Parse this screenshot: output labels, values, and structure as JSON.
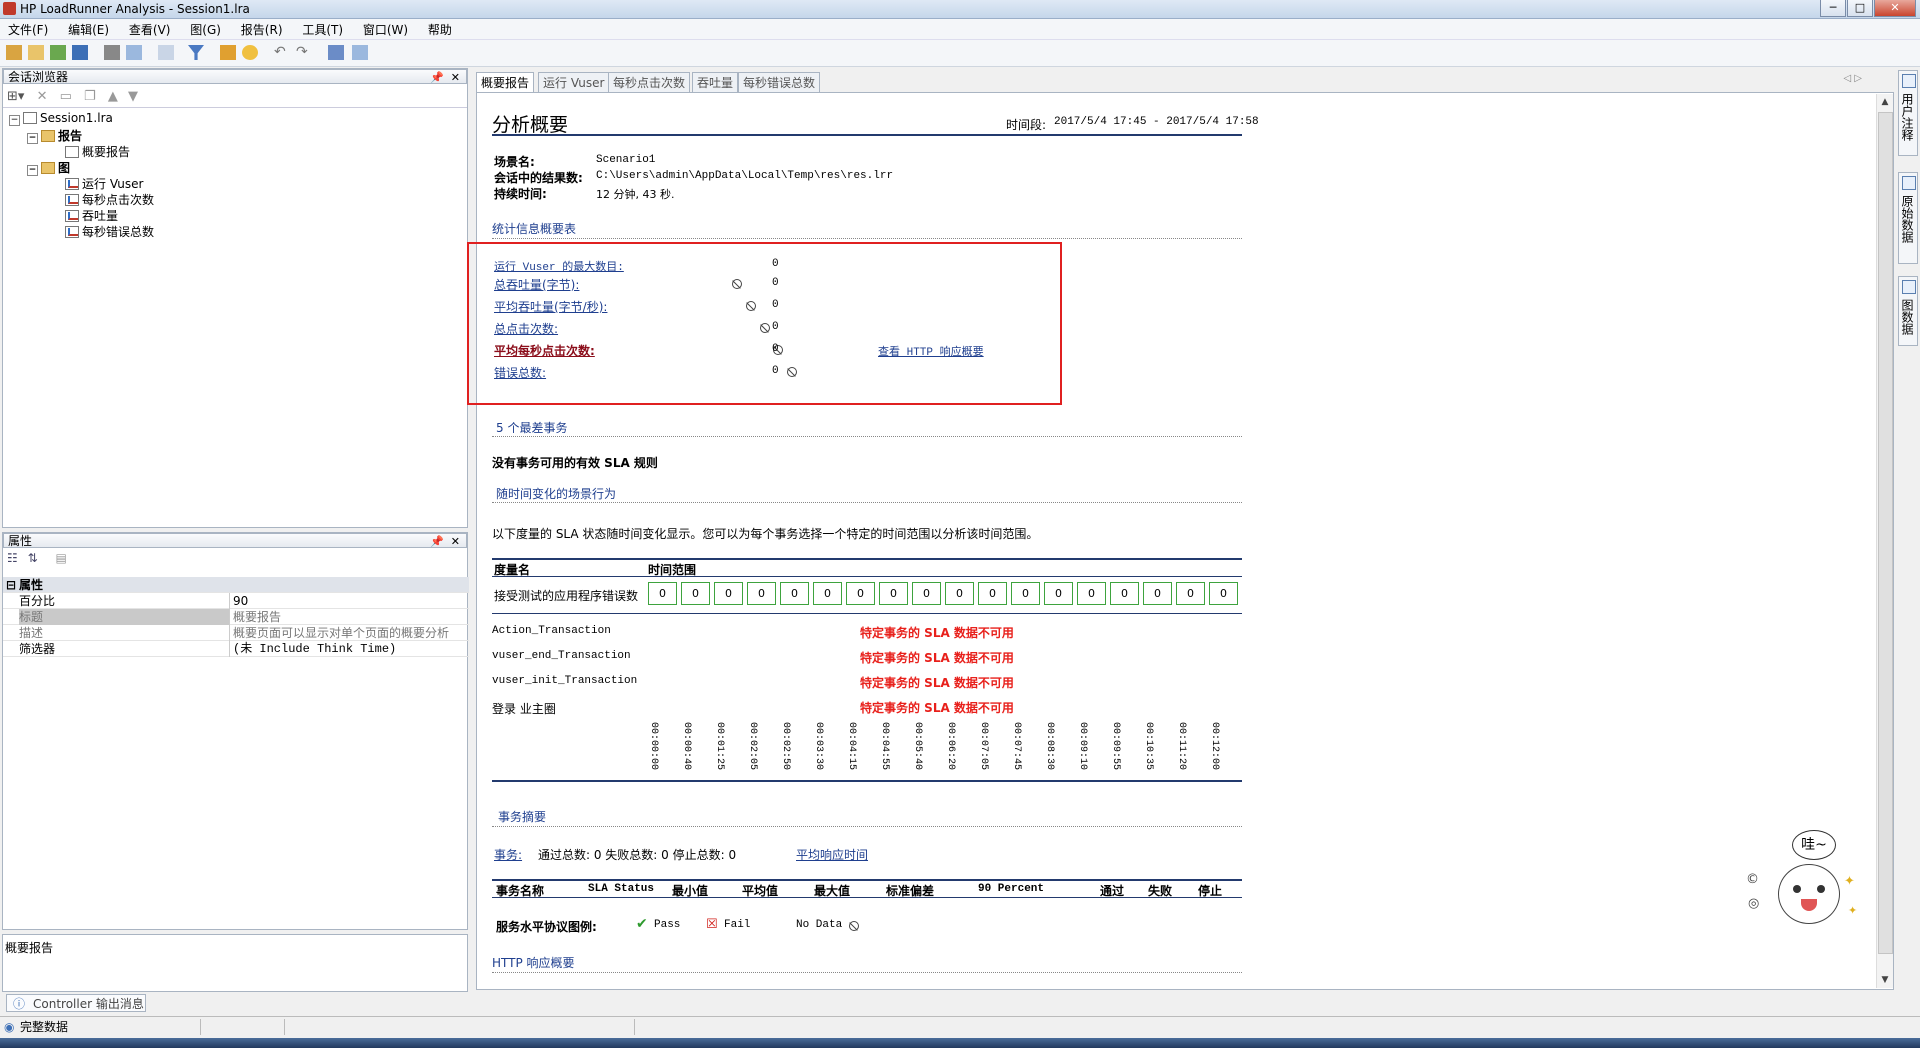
{
  "window": {
    "title": "HP LoadRunner Analysis - Session1.lra",
    "controls": [
      "─",
      "□",
      "✕"
    ]
  },
  "menu": [
    "文件(F)",
    "编辑(E)",
    "查看(V)",
    "图(G)",
    "报告(R)",
    "工具(T)",
    "窗口(W)",
    "帮助"
  ],
  "session_browser": {
    "title": "会话浏览器",
    "tree": {
      "root": "Session1.lra",
      "reports_folder": "报告",
      "summary_report": "概要报告",
      "graphs_folder": "图",
      "graphs": [
        "运行 Vuser",
        "每秒点击次数",
        "吞吐量",
        "每秒错误总数"
      ]
    }
  },
  "properties": {
    "title": "属性",
    "group": "属性",
    "rows": [
      {
        "key": "百分比",
        "value": "90"
      },
      {
        "key": "标题",
        "value": "概要报告"
      },
      {
        "key": "描述",
        "value": "概要页面可以显示对单个页面的概要分析"
      },
      {
        "key": "筛选器",
        "value": "(未 Include Think Time)"
      }
    ],
    "description_text": "概要报告"
  },
  "doc_tabs": [
    "概要报告",
    "运行 Vuser",
    "每秒点击次数",
    "吞吐量",
    "每秒错误总数"
  ],
  "side_tabs": [
    "用户注释",
    "原始数据",
    "图数据"
  ],
  "report": {
    "title": "分析概要",
    "period_label": "时间段:",
    "period": "2017/5/4 17:45 - 2017/5/4 17:58",
    "scenario_label": "场景名:",
    "scenario": "Scenario1",
    "results_label": "会话中的结果数:",
    "results": "C:\\Users\\admin\\AppData\\Local\\Temp\\res\\res.lrr",
    "duration_label": "持续时间:",
    "duration": "12 分钟, 43 秒.",
    "stats_title": "统计信息概要表",
    "stats": [
      {
        "label": "运行 Vuser 的最大数目:",
        "value": "0"
      },
      {
        "label": "总吞吐量(字节):",
        "value": "0"
      },
      {
        "label": "平均吞吐量(字节/秒):",
        "value": "0"
      },
      {
        "label": "总点击次数:",
        "value": "0"
      },
      {
        "label": "平均每秒点击次数:",
        "value": "0"
      },
      {
        "label": "错误总数:",
        "value": "0"
      }
    ],
    "http_link": "查看 HTTP 响应概要",
    "worst5_title": "5 个最差事务",
    "no_sla": "没有事务可用的有效 SLA 规则",
    "scenario_behavior_title": "随时间变化的场景行为",
    "behavior_desc": "以下度量的 SLA 状态随时间变化显示。您可以为每个事务选择一个特定的时间范围以分析该时间范围。",
    "measure_header": "度量名",
    "time_range_header": "时间范围",
    "error_row_label": "接受测试的应用程序错误数",
    "error_cells": [
      "0",
      "0",
      "0",
      "0",
      "0",
      "0",
      "0",
      "0",
      "0",
      "0",
      "0",
      "0",
      "0",
      "0",
      "0",
      "0",
      "0",
      "0"
    ],
    "transactions": [
      {
        "name": "Action_Transaction",
        "status": "特定事务的 SLA 数据不可用"
      },
      {
        "name": "vuser_end_Transaction",
        "status": "特定事务的 SLA 数据不可用"
      },
      {
        "name": "vuser_init_Transaction",
        "status": "特定事务的 SLA 数据不可用"
      },
      {
        "name": "登录 业主圈",
        "status": "特定事务的 SLA 数据不可用"
      }
    ],
    "time_ticks": [
      "00:00:00",
      "00:00:40",
      "00:01:25",
      "00:02:05",
      "00:02:50",
      "00:03:30",
      "00:04:15",
      "00:04:55",
      "00:05:40",
      "00:06:20",
      "00:07:05",
      "00:07:45",
      "00:08:30",
      "00:09:10",
      "00:09:55",
      "00:10:35",
      "00:11:20",
      "00:12:00"
    ],
    "txn_summary_title": "事务摘要",
    "txn_link": "事务:",
    "txn_counts": "通过总数: 0 失败总数: 0 停止总数: 0",
    "avg_response_link": "平均响应时间",
    "txn_table_headers": [
      "事务名称",
      "SLA Status",
      "最小值",
      "平均值",
      "最大值",
      "标准偏差",
      "90 Percent",
      "通过",
      "失败",
      "停止"
    ],
    "legend_label": "服务水平协议图例:",
    "legend": [
      "Pass",
      "Fail",
      "No Data"
    ],
    "http_summary_title": "HTTP 响应概要"
  },
  "bottom_tab": "Controller 输出消息",
  "status": "完整数据",
  "colors": {
    "accent_link": "#1f3f8f",
    "sla_red": "#e8201b",
    "highlight_box": "#e02020",
    "cell_border": "#3ea33e"
  },
  "sticker_text": "哇~"
}
